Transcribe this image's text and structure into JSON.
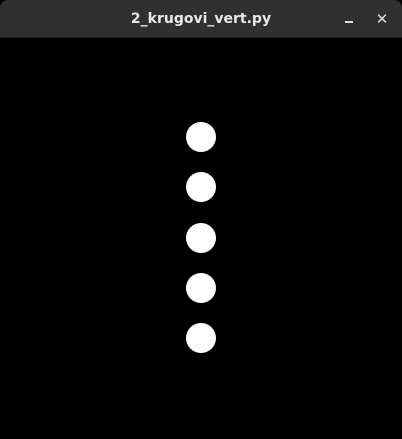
{
  "window": {
    "title": "2_krugovi_vert.py",
    "minimize_icon": "minimize-icon",
    "close_icon": "close-icon",
    "close_glyph": "✕"
  },
  "canvas": {
    "background": "#000000",
    "circle_color": "#ffffff",
    "circles": [
      {
        "label": "circle-1"
      },
      {
        "label": "circle-2"
      },
      {
        "label": "circle-3"
      },
      {
        "label": "circle-4"
      },
      {
        "label": "circle-5"
      }
    ]
  }
}
